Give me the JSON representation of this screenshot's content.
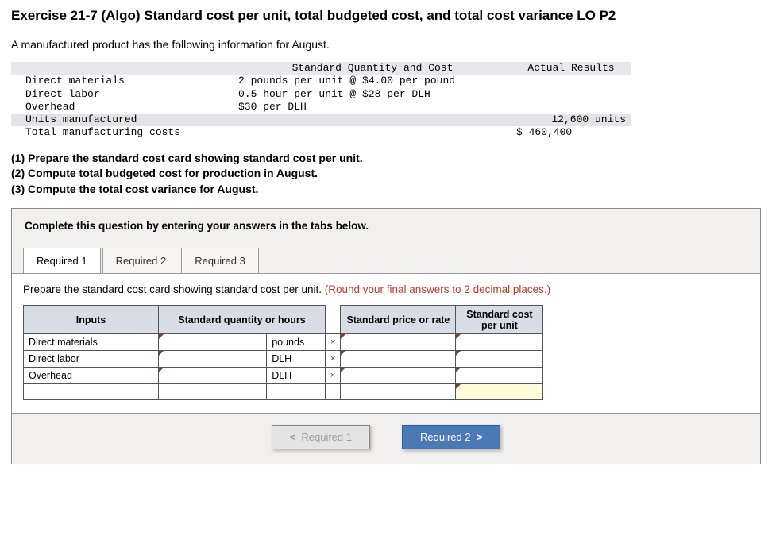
{
  "title": "Exercise 21-7 (Algo) Standard cost per unit, total budgeted cost, and total cost variance LO P2",
  "intro": "A manufactured product has the following information for August.",
  "info": {
    "header_std": "Standard Quantity and Cost",
    "header_act": "Actual Results",
    "rows": [
      {
        "label": "Direct materials",
        "std": "2 pounds per unit @ $4.00 per pound",
        "act": ""
      },
      {
        "label": "Direct labor",
        "std": "0.5 hour per unit @ $28 per DLH",
        "act": ""
      },
      {
        "label": "Overhead",
        "std": "$30 per DLH",
        "act": ""
      },
      {
        "label": "Units manufactured",
        "std": "",
        "act": "12,600 units"
      },
      {
        "label": "Total manufacturing costs",
        "std": "",
        "act": "$ 460,400"
      }
    ]
  },
  "questions": {
    "q1": "(1) Prepare the standard cost card showing standard cost per unit.",
    "q2": "(2) Compute total budgeted cost for production in August.",
    "q3": "(3) Compute the total cost variance for August."
  },
  "box": {
    "instruction": "Complete this question by entering your answers in the tabs below.",
    "tabs": [
      "Required 1",
      "Required 2",
      "Required 3"
    ],
    "active_tab": 0,
    "prompt_main": "Prepare the standard cost card showing standard cost per unit. ",
    "prompt_note": "(Round your final answers to 2 decimal places.)",
    "grid": {
      "headers": {
        "inputs": "Inputs",
        "sqh": "Standard quantity or hours",
        "spr": "Standard price or rate",
        "scpu": "Standard cost per unit"
      },
      "rows": [
        {
          "label": "Direct materials",
          "unit": "pounds"
        },
        {
          "label": "Direct labor",
          "unit": "DLH"
        },
        {
          "label": "Overhead",
          "unit": "DLH"
        }
      ],
      "mult": "×"
    },
    "nav": {
      "prev": "Required 1",
      "next": "Required 2"
    }
  }
}
